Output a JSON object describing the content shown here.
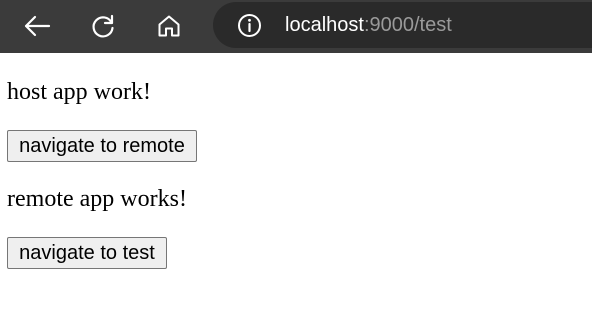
{
  "browser": {
    "address": {
      "host": "localhost",
      "path": ":9000/test"
    },
    "icons": {
      "back": "back-arrow-icon",
      "reload": "reload-icon",
      "home": "home-icon",
      "info": "info-icon"
    },
    "colors": {
      "toolbar_bg": "#3b3b3b",
      "address_bg": "#2a2a2a",
      "host_text": "#ffffff",
      "path_text": "#9a9a9a"
    }
  },
  "page": {
    "host_message": "host app work!",
    "navigate_remote_label": "navigate to remote",
    "remote_message": "remote app works!",
    "navigate_test_label": "navigate to test"
  }
}
